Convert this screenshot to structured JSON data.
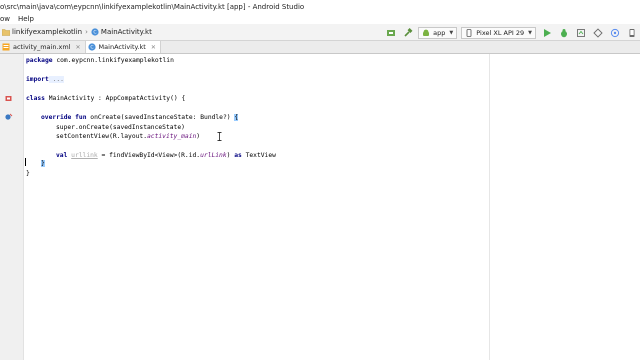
{
  "window": {
    "title_path": "o\\src\\main\\java\\com\\eypcnn\\linkifyexamplekotlin\\MainActivity.kt [app] - Android Studio"
  },
  "menu": [
    "ow",
    "Help"
  ],
  "breadcrumbs": [
    "linkifyexamplekotlin",
    "MainActivity.kt"
  ],
  "toolbar": {
    "module": "app",
    "device": "Pixel XL API 29"
  },
  "tabs": [
    {
      "label": "activity_main.xml",
      "active": false
    },
    {
      "label": "MainActivity.kt",
      "active": true
    }
  ],
  "code": {
    "l1_kw": "package",
    "l1_rest": " com.eypcnn.linkifyexamplekotlin",
    "l2_kw": "import",
    "l2_fold": " ...",
    "l3_kw": "class",
    "l3_rest": " MainActivity : AppCompatActivity() {",
    "l4_kw": "override fun",
    "l4_rest": " onCreate(savedInstanceState: Bundle?) ",
    "l4_brace": "{",
    "l5": "super.onCreate(savedInstanceState)",
    "l6_a": "setContentView(R.layout.",
    "l6_b": "activity_main",
    "l6_c": ")",
    "l7_kw": "val",
    "l7_var": "urllink",
    "l7_a": " = findViewById<View>(R.id.",
    "l7_b": "urlLink",
    "l7_c": ") ",
    "l7_kw2": "as",
    "l7_d": " TextView",
    "l8_brace": "}",
    "l9_brace": "}"
  },
  "colors": {
    "keyword": "#000080",
    "resource": "#660e7a",
    "gutter": "#f0f0f0"
  }
}
